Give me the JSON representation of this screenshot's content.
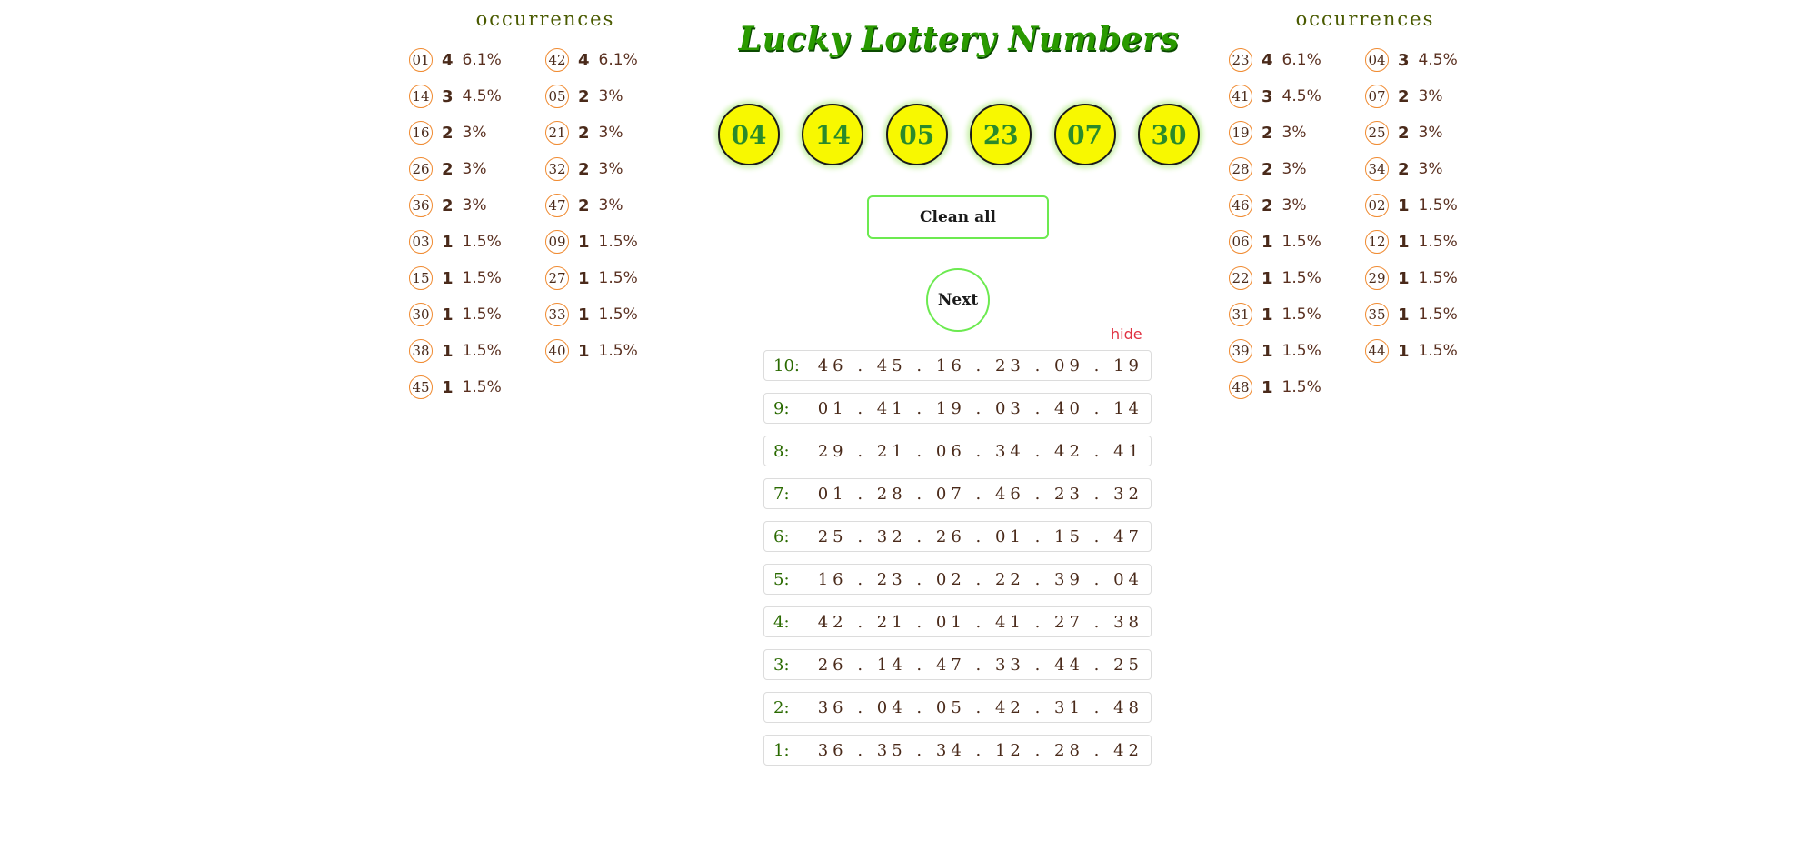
{
  "title": "Lucky Lottery Numbers",
  "left_occurrences": {
    "heading": "occurrences",
    "columns": [
      [
        {
          "num": "01",
          "count": "4",
          "pct": "6.1%"
        },
        {
          "num": "14",
          "count": "3",
          "pct": "4.5%"
        },
        {
          "num": "16",
          "count": "2",
          "pct": "3%"
        },
        {
          "num": "26",
          "count": "2",
          "pct": "3%"
        },
        {
          "num": "36",
          "count": "2",
          "pct": "3%"
        },
        {
          "num": "03",
          "count": "1",
          "pct": "1.5%"
        },
        {
          "num": "15",
          "count": "1",
          "pct": "1.5%"
        },
        {
          "num": "30",
          "count": "1",
          "pct": "1.5%"
        },
        {
          "num": "38",
          "count": "1",
          "pct": "1.5%"
        },
        {
          "num": "45",
          "count": "1",
          "pct": "1.5%"
        }
      ],
      [
        {
          "num": "42",
          "count": "4",
          "pct": "6.1%"
        },
        {
          "num": "05",
          "count": "2",
          "pct": "3%"
        },
        {
          "num": "21",
          "count": "2",
          "pct": "3%"
        },
        {
          "num": "32",
          "count": "2",
          "pct": "3%"
        },
        {
          "num": "47",
          "count": "2",
          "pct": "3%"
        },
        {
          "num": "09",
          "count": "1",
          "pct": "1.5%"
        },
        {
          "num": "27",
          "count": "1",
          "pct": "1.5%"
        },
        {
          "num": "33",
          "count": "1",
          "pct": "1.5%"
        },
        {
          "num": "40",
          "count": "1",
          "pct": "1.5%"
        }
      ]
    ]
  },
  "right_occurrences": {
    "heading": "occurrences",
    "columns": [
      [
        {
          "num": "23",
          "count": "4",
          "pct": "6.1%"
        },
        {
          "num": "41",
          "count": "3",
          "pct": "4.5%"
        },
        {
          "num": "19",
          "count": "2",
          "pct": "3%"
        },
        {
          "num": "28",
          "count": "2",
          "pct": "3%"
        },
        {
          "num": "46",
          "count": "2",
          "pct": "3%"
        },
        {
          "num": "06",
          "count": "1",
          "pct": "1.5%"
        },
        {
          "num": "22",
          "count": "1",
          "pct": "1.5%"
        },
        {
          "num": "31",
          "count": "1",
          "pct": "1.5%"
        },
        {
          "num": "39",
          "count": "1",
          "pct": "1.5%"
        },
        {
          "num": "48",
          "count": "1",
          "pct": "1.5%"
        }
      ],
      [
        {
          "num": "04",
          "count": "3",
          "pct": "4.5%"
        },
        {
          "num": "07",
          "count": "2",
          "pct": "3%"
        },
        {
          "num": "25",
          "count": "2",
          "pct": "3%"
        },
        {
          "num": "34",
          "count": "2",
          "pct": "3%"
        },
        {
          "num": "02",
          "count": "1",
          "pct": "1.5%"
        },
        {
          "num": "12",
          "count": "1",
          "pct": "1.5%"
        },
        {
          "num": "29",
          "count": "1",
          "pct": "1.5%"
        },
        {
          "num": "35",
          "count": "1",
          "pct": "1.5%"
        },
        {
          "num": "44",
          "count": "1",
          "pct": "1.5%"
        }
      ]
    ]
  },
  "current_draw": [
    "04",
    "14",
    "05",
    "23",
    "07",
    "30"
  ],
  "buttons": {
    "clean_all": "Clean all",
    "next": "Next",
    "hide": "hide"
  },
  "history": [
    {
      "label": "10:",
      "numbers": "46 . 45 . 16 . 23 . 09 . 19"
    },
    {
      "label": "9:",
      "numbers": "01 . 41 . 19 . 03 . 40 . 14"
    },
    {
      "label": "8:",
      "numbers": "29 . 21 . 06 . 34 . 42 . 41"
    },
    {
      "label": "7:",
      "numbers": "01 . 28 . 07 . 46 . 23 . 32"
    },
    {
      "label": "6:",
      "numbers": "25 . 32 . 26 . 01 . 15 . 47"
    },
    {
      "label": "5:",
      "numbers": "16 . 23 . 02 . 22 . 39 . 04"
    },
    {
      "label": "4:",
      "numbers": "42 . 21 . 01 . 41 . 27 . 38"
    },
    {
      "label": "3:",
      "numbers": "26 . 14 . 47 . 33 . 44 . 25"
    },
    {
      "label": "2:",
      "numbers": "36 . 04 . 05 . 42 . 31 . 48"
    },
    {
      "label": "1:",
      "numbers": "36 . 35 . 34 . 12 . 28 . 42"
    }
  ],
  "colors": {
    "title_green": "#2a9a00",
    "ball_yellow": "#f8f800",
    "occurrence_ring": "#f08a30",
    "button_border": "#6cea50",
    "hide_red": "#e03040"
  }
}
